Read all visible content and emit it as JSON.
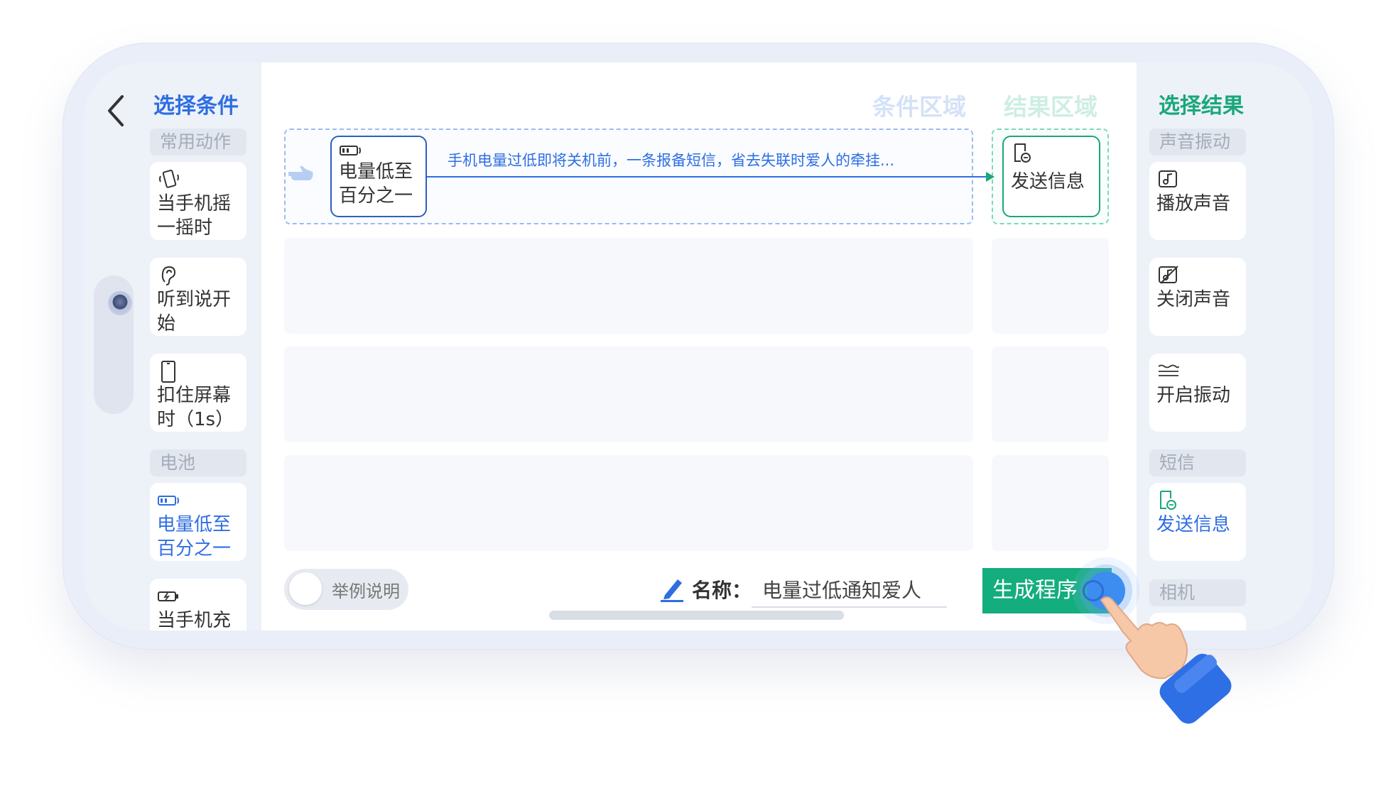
{
  "left_panel": {
    "title": "选择条件",
    "sections": [
      {
        "label": "常用动作",
        "items": [
          {
            "line1": "当手机摇",
            "line2": "一摇时",
            "icon": "shake-phone-icon"
          },
          {
            "line1": "听到说开",
            "line2": "始",
            "icon": "ear-icon"
          },
          {
            "line1": "扣住屏幕",
            "line2": "时（1s）",
            "icon": "phone-outline-icon"
          }
        ]
      },
      {
        "label": "电池",
        "items": [
          {
            "line1": "电量低至",
            "line2": "百分之一",
            "icon": "battery-low-icon",
            "selected": true
          },
          {
            "line1": "当手机充",
            "line2": "",
            "icon": "battery-charging-icon"
          }
        ]
      }
    ]
  },
  "right_panel": {
    "title": "选择结果",
    "sections": [
      {
        "label": "声音振动",
        "items": [
          {
            "label": "播放声音",
            "icon": "music-note-icon"
          },
          {
            "label": "关闭声音",
            "icon": "mute-icon"
          },
          {
            "label": "开启振动",
            "icon": "vibration-icon"
          }
        ]
      },
      {
        "label": "短信",
        "items": [
          {
            "label": "发送信息",
            "icon": "message-icon",
            "selected": true
          }
        ]
      },
      {
        "label": "相机",
        "items": []
      }
    ]
  },
  "canvas": {
    "condition_zone_title": "条件区域",
    "result_zone_title": "结果区域",
    "condition_chip": {
      "line1": "电量低至",
      "line2": "百分之一",
      "icon": "battery-low-icon"
    },
    "result_chip": {
      "label": "发送信息",
      "icon": "message-icon"
    },
    "connection_text": "手机电量过低即将关机前，一条报备短信，省去失联时爱人的牵挂..."
  },
  "footer": {
    "toggle_label": "举例说明",
    "toggle_on": false,
    "name_label": "名称：",
    "name_value": "电量过低通知爱人",
    "generate_button": "生成程序"
  },
  "colors": {
    "primary_blue": "#2f6ee2",
    "primary_green": "#14ad7d",
    "panel_bg": "#edf1f8"
  }
}
